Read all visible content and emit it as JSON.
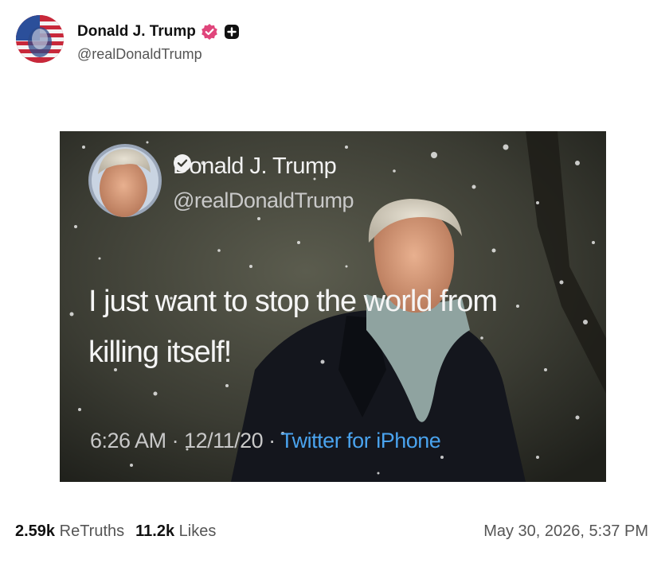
{
  "post": {
    "author": {
      "display_name": "Donald J. Trump",
      "handle": "@realDonaldTrump",
      "avatar_icon": "flag-portrait-avatar",
      "verified_icon": "verified-badge-icon",
      "extra_badge_icon": "plus-badge-icon"
    },
    "media": {
      "tweet": {
        "display_name": "Donald J. Trump",
        "handle": "@realDonaldTrump",
        "text_line1": "I just want to stop the world from",
        "text_line2": "killing itself!",
        "time_date": "6:26 AM · 12/11/20 · ",
        "source": "Twitter for iPhone"
      }
    },
    "stats": {
      "retruths_count": "2.59k",
      "retruths_label": "ReTruths",
      "likes_count": "11.2k",
      "likes_label": "Likes"
    },
    "timestamp": "May 30, 2026, 5:37 PM"
  },
  "colors": {
    "verified": "#e0457b",
    "link_blue": "#4aa3ee",
    "text_primary": "#111111",
    "text_secondary": "#555555"
  }
}
